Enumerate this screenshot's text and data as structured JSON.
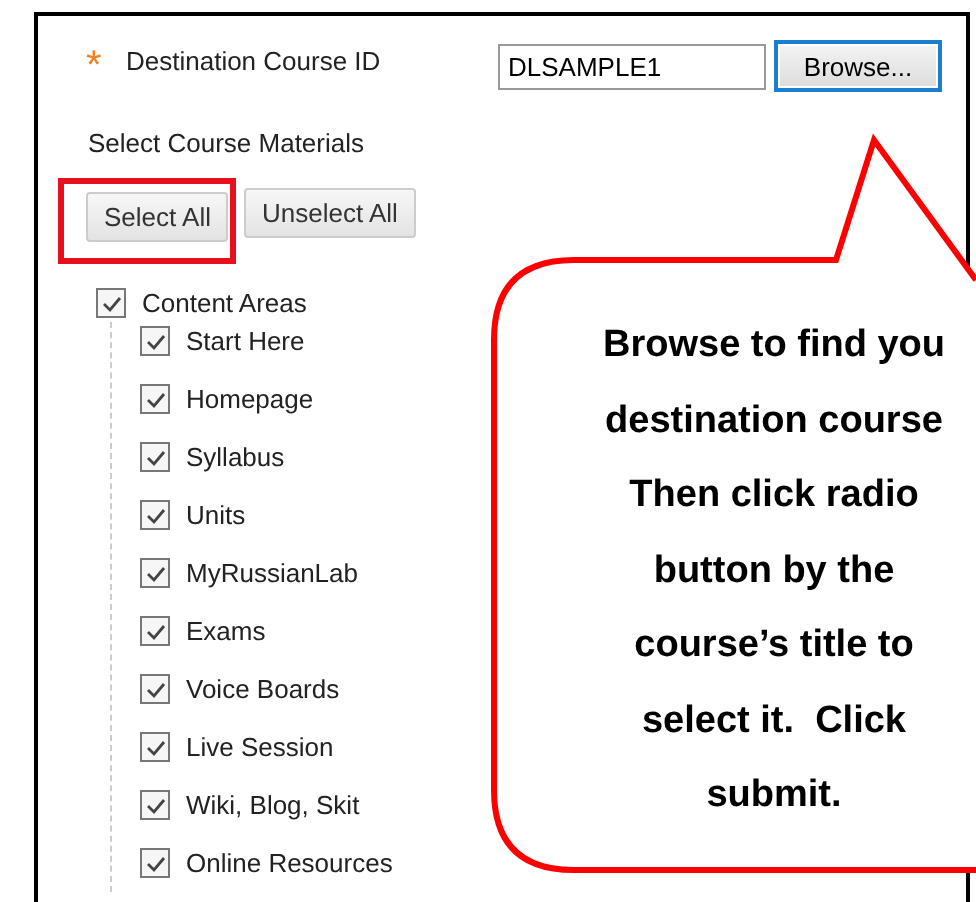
{
  "destination": {
    "required_mark": "*",
    "label": "Destination Course ID",
    "value": "DLSAMPLE1",
    "browse_button": "Browse..."
  },
  "materials": {
    "heading": "Select Course Materials",
    "buttons": [
      {
        "label": "Select All",
        "highlighted": true
      },
      {
        "label": "Unselect All",
        "highlighted": false
      }
    ],
    "tree": [
      {
        "label": "Content Areas",
        "checked": true,
        "children": [
          {
            "label": "Start Here",
            "checked": true
          },
          {
            "label": "Homepage",
            "checked": true
          },
          {
            "label": "Syllabus",
            "checked": true
          },
          {
            "label": "Units",
            "checked": true
          },
          {
            "label": "MyRussianLab",
            "checked": true
          },
          {
            "label": "Exams",
            "checked": true
          },
          {
            "label": "Voice Boards",
            "checked": true
          },
          {
            "label": "Live Session",
            "checked": true
          },
          {
            "label": "Wiki, Blog, Skit",
            "checked": true
          },
          {
            "label": "Online Resources",
            "checked": true
          }
        ]
      }
    ]
  },
  "callout": {
    "lines": [
      "Browse to find you",
      "destination course",
      "Then click radio",
      "button by the",
      "course’s title to",
      "select it.  Click",
      "submit."
    ]
  }
}
